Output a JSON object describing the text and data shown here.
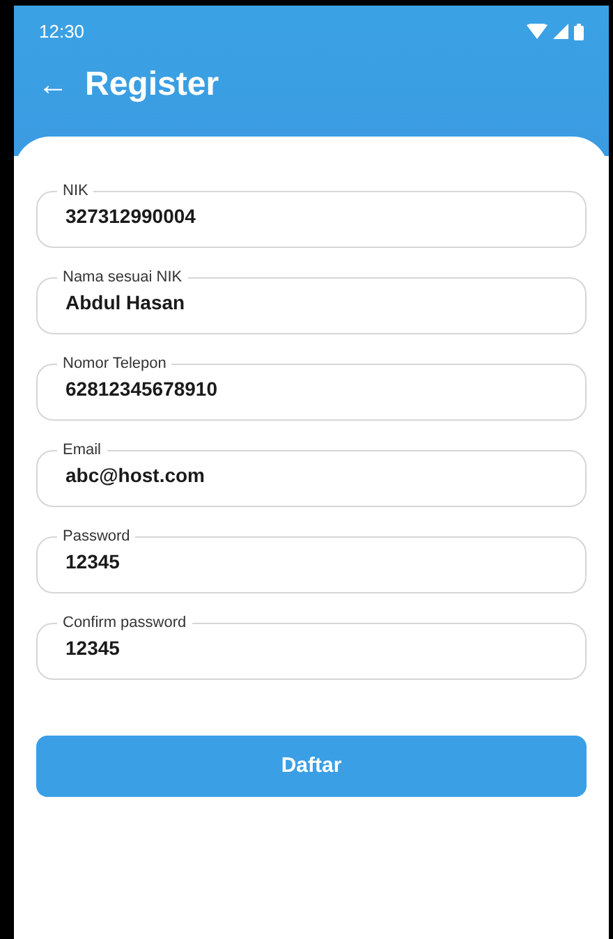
{
  "status_bar": {
    "time": "12:30"
  },
  "app_bar": {
    "back": "←",
    "title": "Register"
  },
  "fields": [
    {
      "label": "NIK",
      "value": "327312990004"
    },
    {
      "label": "Nama sesuai NIK",
      "value": "Abdul Hasan"
    },
    {
      "label": "Nomor Telepon",
      "value": "62812345678910"
    },
    {
      "label": "Email",
      "value": "abc@host.com"
    },
    {
      "label": "Password",
      "value": "12345"
    },
    {
      "label": "Confirm password",
      "value": "12345"
    }
  ],
  "submit_button": "Daftar"
}
